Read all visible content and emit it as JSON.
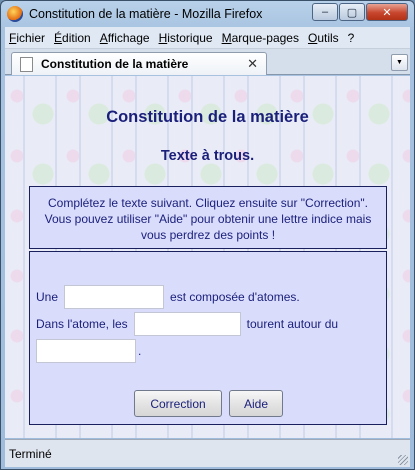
{
  "window": {
    "title": "Constitution de la matière - Mozilla Firefox",
    "caption_buttons": {
      "minimize": "–",
      "maximize": "▢",
      "close": "✕"
    }
  },
  "menubar": {
    "items": [
      "Fichier",
      "Édition",
      "Affichage",
      "Historique",
      "Marque-pages",
      "Outils",
      "?"
    ]
  },
  "tabs": {
    "active_label": "Constitution de la matière",
    "close_glyph": "✕",
    "list_glyph": "▼"
  },
  "page": {
    "title": "Constitution de la matière",
    "subtitle": "Texte à trous.",
    "instructions": "Complétez le texte suivant. Cliquez ensuite sur \"Correction\". Vous pouvez utiliser \"Aide\" pour obtenir une lettre indice mais vous perdrez des points !",
    "exercise": {
      "line1_before": "Une",
      "line1_after": "est composée d'atomes.",
      "line2_before": "Dans l'atome, les",
      "line2_after": "tourent autour du",
      "line3_after": ".",
      "blank1_value": "",
      "blank2_value": "",
      "blank3_value": ""
    },
    "buttons": {
      "correction": "Correction",
      "aide": "Aide"
    }
  },
  "statusbar": {
    "text": "Terminé"
  },
  "colors": {
    "heading": "#1a1f7a",
    "panel": "#d9dcfb",
    "border": "#1a1f5e"
  }
}
